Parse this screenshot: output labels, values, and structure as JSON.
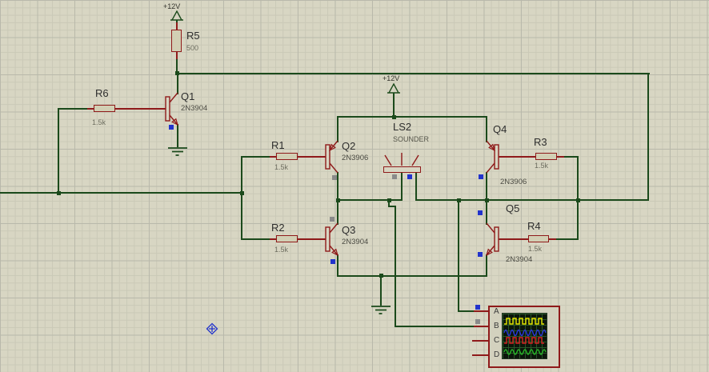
{
  "power": {
    "top": "+12V",
    "center": "+12V"
  },
  "components": {
    "R5": {
      "ref": "R5",
      "value": "500"
    },
    "R6": {
      "ref": "R6",
      "value": "1.5k"
    },
    "R1": {
      "ref": "R1",
      "value": "1.5k"
    },
    "R2": {
      "ref": "R2",
      "value": "1.5k"
    },
    "R3": {
      "ref": "R3",
      "value": "1.5k"
    },
    "R4": {
      "ref": "R4",
      "value": "1.5k"
    },
    "Q1": {
      "ref": "Q1",
      "value": "2N3904"
    },
    "Q2": {
      "ref": "Q2",
      "value": "2N3906"
    },
    "Q3": {
      "ref": "Q3",
      "value": "2N3904"
    },
    "Q4": {
      "ref": "Q4",
      "value": "2N3906"
    },
    "Q5": {
      "ref": "Q5",
      "value": "2N3904"
    },
    "LS2": {
      "ref": "LS2",
      "value": "SOUNDER"
    }
  },
  "oscilloscope": {
    "channels": [
      "A",
      "B",
      "C",
      "D"
    ],
    "traces": [
      {
        "channel": "A",
        "color": "#e6e600",
        "shape": "square"
      },
      {
        "channel": "B",
        "color": "#2a35d8",
        "shape": "sine"
      },
      {
        "channel": "C",
        "color": "#d42222",
        "shape": "square"
      },
      {
        "channel": "D",
        "color": "#27b427",
        "shape": "sine"
      }
    ]
  },
  "colors": {
    "background": "#d8d6c3",
    "grid_minor": "#cac9b7",
    "grid_major": "#b9b9ab",
    "wire": "#1b4a1b",
    "component": "#8f1a1a",
    "marker_blue": "#2233cc",
    "marker_gray": "#8a8a8a"
  }
}
